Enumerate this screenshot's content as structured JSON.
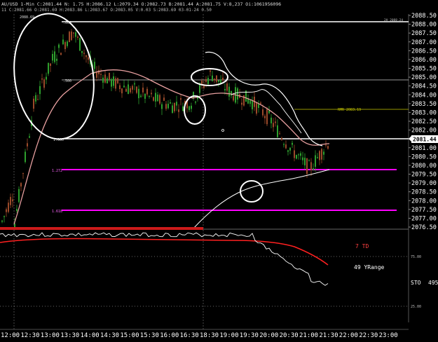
{
  "header": {
    "line1": "AU/USD  1-Min  C:2081.44  N:  1.75  H:2086.12  L:2079.34  O:2082.73  B:2081.44  A:2081.75  V:8,237  Oi:1061956096",
    "line2": "11  C:2081.66  O:2081.69  H:2083.86  L:2083.67  O:2083.05  V:0.03  S:2083.69  03-01-24  0.50"
  },
  "price_panel": {
    "price_min": 2076.5,
    "price_max": 2088.5,
    "price_ticks": [
      "2088.50",
      "2088.00",
      "2087.50",
      "2087.00",
      "2086.50",
      "2086.00",
      "2085.50",
      "2085.00",
      "2084.50",
      "2084.00",
      "2083.50",
      "2083.00",
      "2082.50",
      "2082.00",
      "2081.50",
      "2081.00",
      "2080.50",
      "2080.00",
      "2079.50",
      "2079.00",
      "2078.50",
      "2078.00",
      "2077.50",
      "2077.00",
      "2076.50"
    ],
    "last_price_label": "2081.44",
    "last_price": 2081.44,
    "high_marker": "2088.69",
    "fib_000_label": ".000",
    "fib_500_label": ".500",
    "fib_1000_label": "1.000",
    "fib_1272_label": "1.272",
    "fib_1618_label": "1.618",
    "top_line_label": "2H 2088.24",
    "rmr_label": "RMR 2083.19",
    "levels": {
      "top_white": 2088.24,
      "mid_white": 2084.92,
      "rmr": 2083.19,
      "low_white": 2081.44,
      "fib_1272": 2079.75,
      "fib_1618": 2077.6
    },
    "colors": {
      "candle": "#2ea02e",
      "candle_down": "#9b4a2a",
      "ma_pink": "#e8a0a0",
      "magenta": "#ff00ff",
      "rmr": "#c8c800",
      "white": "#ffffff"
    }
  },
  "indicator_panel": {
    "label_7td": "7 TD",
    "label_49yr": "49 YRange",
    "label_sto": "STO",
    "label_sto_value": "495",
    "level_75": "75.00",
    "level_25": "25.00",
    "colors": {
      "td": "#ff2020",
      "sto": "#ffffff"
    }
  },
  "time_axis": [
    "12:00",
    "12:30",
    "13:00",
    "13:30",
    "14:00",
    "14:30",
    "15:00",
    "15:30",
    "16:00",
    "16:30",
    "18:30",
    "19:00",
    "19:30",
    "20:00",
    "20:30",
    "21:00",
    "21:30",
    "22:00",
    "22:30",
    "23:00"
  ],
  "chart_data": {
    "type": "line",
    "title": "",
    "x": [
      "12:00",
      "12:30",
      "13:00",
      "13:30",
      "14:00",
      "14:30",
      "15:00",
      "15:30",
      "16:00",
      "16:30",
      "18:30",
      "19:00",
      "19:30",
      "20:00",
      "20:30",
      "21:00",
      "21:30"
    ],
    "series": [
      {
        "values": [
          2076.5,
          2083.4,
          2086.1,
          2087.6,
          2085.5,
          2084.7,
          2084.3,
          2083.8,
          2083.4,
          2083.6,
          2085.2,
          2084.1,
          2083.7,
          2082.6,
          2081.0,
          2079.8,
          2081.4
        ]
      }
    ],
    "ylabel": "",
    "ylim": [
      2076.5,
      2088.5
    ]
  }
}
